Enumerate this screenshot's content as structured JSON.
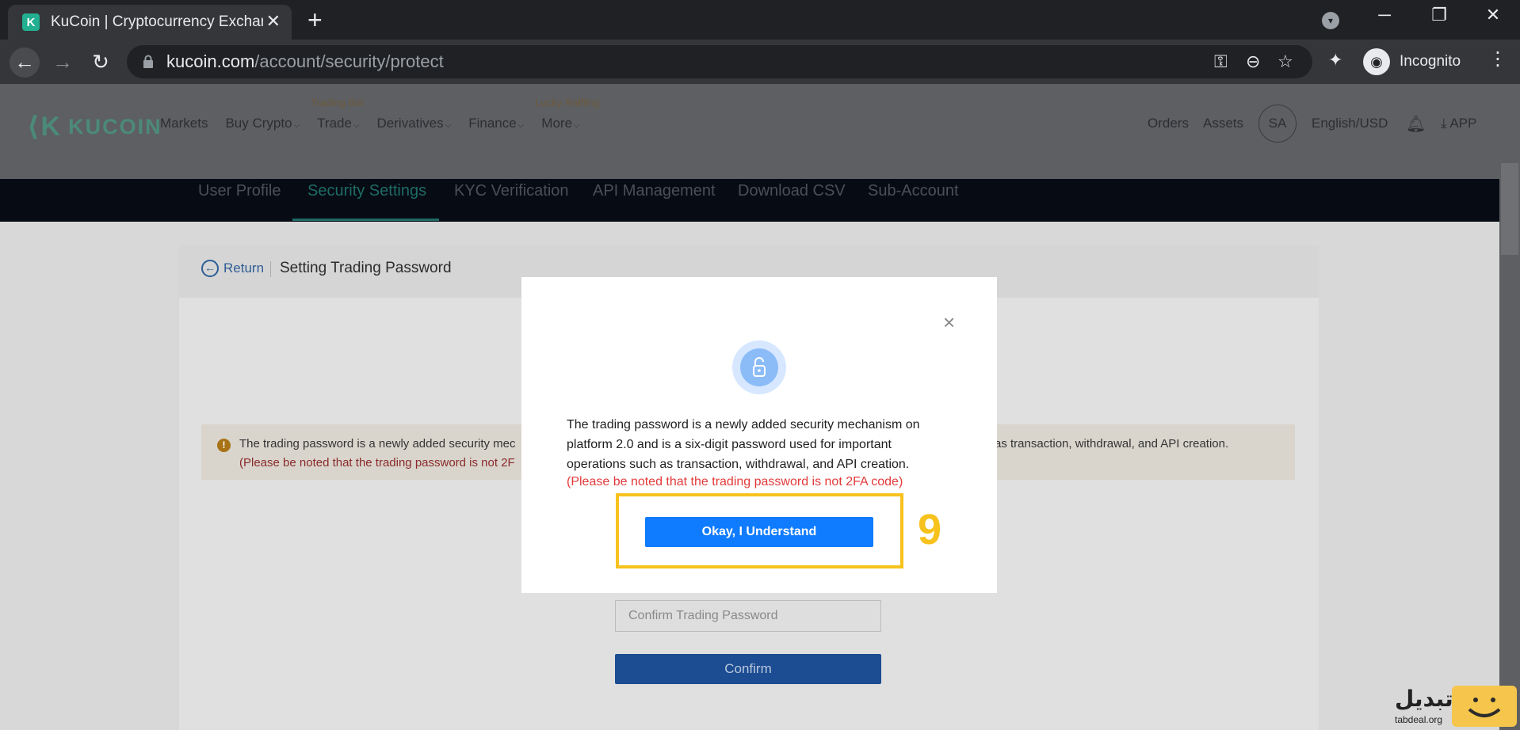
{
  "browser": {
    "tab_title": "KuCoin | Cryptocurrency Exchang",
    "new_tab_symbol": "+",
    "close_symbol": "✕",
    "url_domain": "kucoin.com",
    "url_path": "/account/security/protect",
    "profile_label": "Incognito"
  },
  "site": {
    "brand": "KUCOIN",
    "nav": [
      {
        "label": "Markets",
        "badge": ""
      },
      {
        "label": "Buy Crypto",
        "badge": "",
        "caret": true
      },
      {
        "label": "Trade",
        "badge": "Trading Bot",
        "caret": true
      },
      {
        "label": "Derivatives",
        "badge": "",
        "caret": true
      },
      {
        "label": "Finance",
        "badge": "",
        "caret": true
      },
      {
        "label": "More",
        "badge": "Lucky Raffling",
        "caret": true
      }
    ],
    "right_nav": {
      "orders": "Orders",
      "assets": "Assets",
      "avatar": "SA",
      "language": "English/USD",
      "app": "APP"
    },
    "subnav": [
      "User Profile",
      "Security Settings",
      "KYC Verification",
      "API Management",
      "Download CSV",
      "Sub-Account"
    ],
    "active_subnav": "Security Settings"
  },
  "page": {
    "return_label": "Return",
    "title": "Setting Trading Password",
    "notice_text": "The trading password is a newly added security mec",
    "notice_tail": "as transaction, withdrawal, and API creation.",
    "notice_red": "(Please be noted that the trading password is not 2F",
    "confirm_placeholder": "Confirm Trading Password",
    "confirm_button": "Confirm"
  },
  "modal": {
    "close_symbol": "×",
    "body": "The trading password is a newly added security mechanism on platform 2.0 and is a six-digit password used for important operations such as transaction, withdrawal, and API creation.",
    "red_note": "(Please be noted that the trading password is not 2FA code)",
    "ok_button": "Okay, I Understand"
  },
  "annotation": {
    "step": "9",
    "color": "#f7c21d"
  },
  "watermark": {
    "text": "تبدیل",
    "sub": "tabdeal.org"
  }
}
